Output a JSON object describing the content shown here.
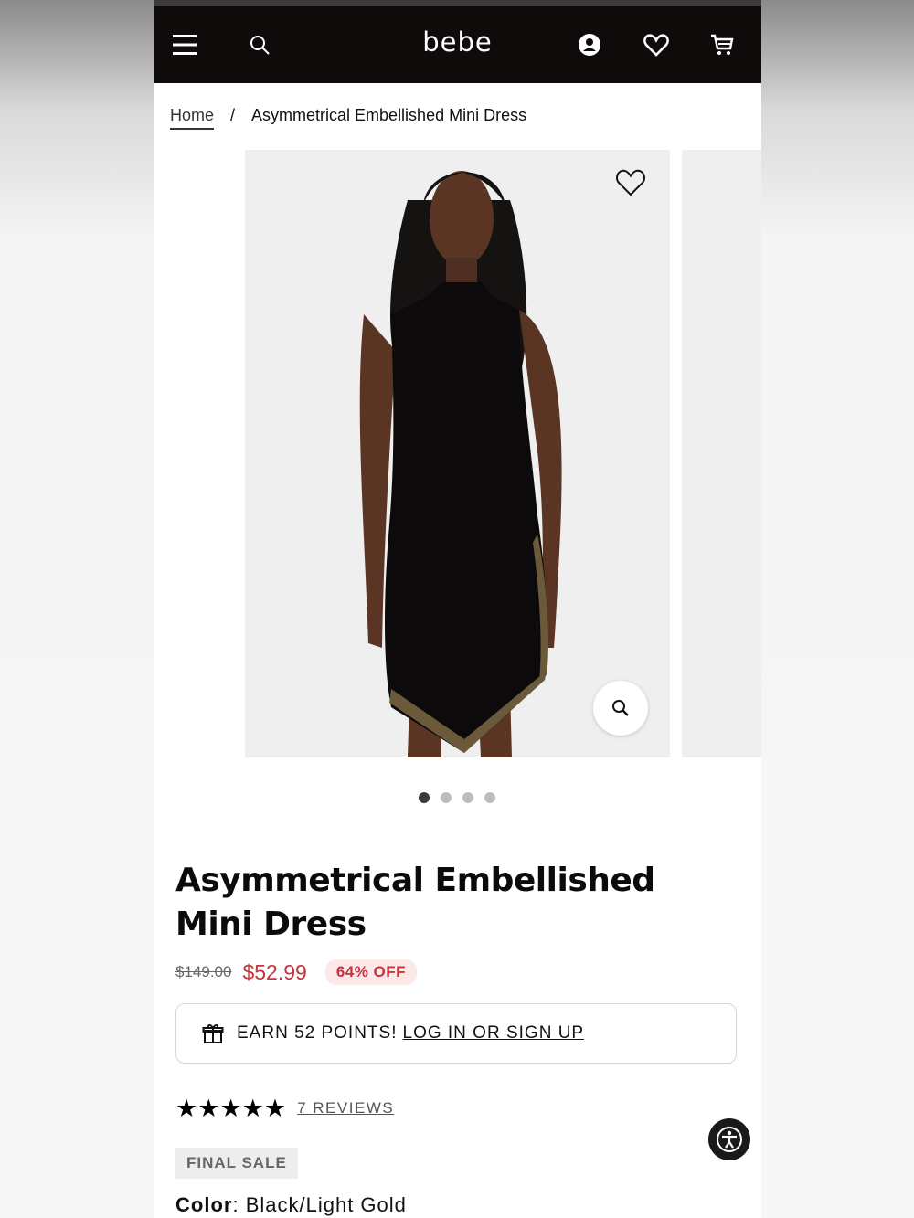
{
  "header": {
    "logo": "bebe",
    "icons": [
      "menu-icon",
      "search-icon",
      "account-icon",
      "wishlist-icon",
      "cart-icon"
    ]
  },
  "breadcrumb": {
    "home": "Home",
    "separator": "/",
    "current": "Asymmetrical Embellished Mini Dress"
  },
  "gallery": {
    "total_images": 4,
    "active_index": 1
  },
  "product": {
    "title": "Asymmetrical Embellished Mini Dress",
    "price_original": "$149.00",
    "price_sale": "$52.99",
    "discount": "64% OFF",
    "points_text": "EARN 52 POINTS!",
    "points_link": "LOG IN OR SIGN UP",
    "rating_stars": 5,
    "reviews_link": "7 REVIEWS",
    "sale_badge": "FINAL SALE",
    "color_label": "Color",
    "color_value": "Black/Light Gold"
  },
  "colors": {
    "header_bg": "#0e0b0a",
    "sale_red": "#c8323a",
    "badge_bg": "#fbe9ea"
  }
}
